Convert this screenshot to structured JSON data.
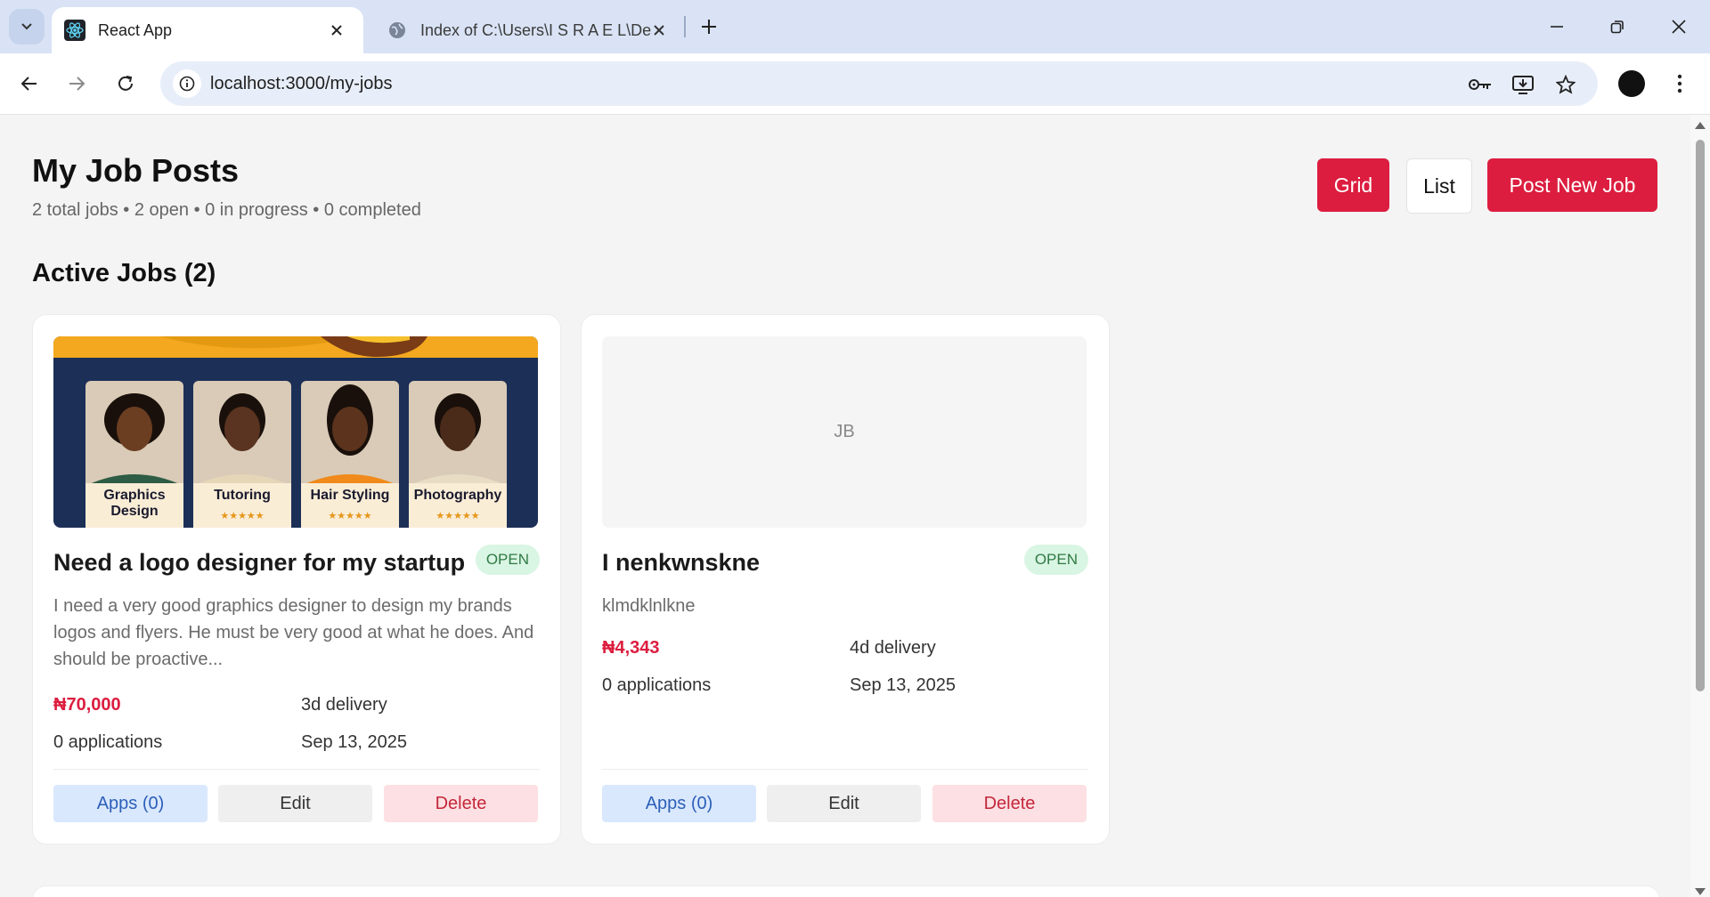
{
  "browser": {
    "tabs": [
      {
        "title": "React App",
        "active": true
      },
      {
        "title": "Index of C:\\Users\\I S R A E L\\Desktop",
        "active": false
      }
    ],
    "url": "localhost:3000/my-jobs"
  },
  "header": {
    "title": "My Job Posts",
    "subtitle": "2 total jobs • 2 open • 0 in progress • 0 completed",
    "grid_label": "Grid",
    "list_label": "List",
    "post_label": "Post New Job"
  },
  "section": {
    "title": "Active Jobs (2)"
  },
  "jobs": [
    {
      "title": "Need a logo designer for my startup",
      "status": "OPEN",
      "description": "I need a very good graphics designer to design my brands logos and flyers. He must be very good at what he does. And should be proactive...",
      "budget": "₦70,000",
      "delivery": "3d delivery",
      "applications": "0 applications",
      "date": "Sep 13, 2025",
      "apps_label": "Apps (0)",
      "edit_label": "Edit",
      "delete_label": "Delete",
      "image": {
        "panels": [
          {
            "label": "Graphics Design",
            "shirt": "#2e5c44"
          },
          {
            "label": "Tutoring",
            "shirt": "#e6d6b8"
          },
          {
            "label": "Hair Styling",
            "shirt": "#f08a1c"
          },
          {
            "label": "Photography",
            "shirt": "#e8dcc4"
          }
        ],
        "stars": "★★★★★"
      }
    },
    {
      "title": "I nenkwnskne",
      "status": "OPEN",
      "description": "klmdklnlkne",
      "budget": "₦4,343",
      "delivery": "4d delivery",
      "applications": "0 applications",
      "date": "Sep 13, 2025",
      "apps_label": "Apps (0)",
      "edit_label": "Edit",
      "delete_label": "Delete",
      "placeholder": "JB"
    }
  ],
  "colors": {
    "accent": "#dc1d3f",
    "open_badge_bg": "#d9f5e3",
    "open_badge_text": "#2f7a45"
  }
}
